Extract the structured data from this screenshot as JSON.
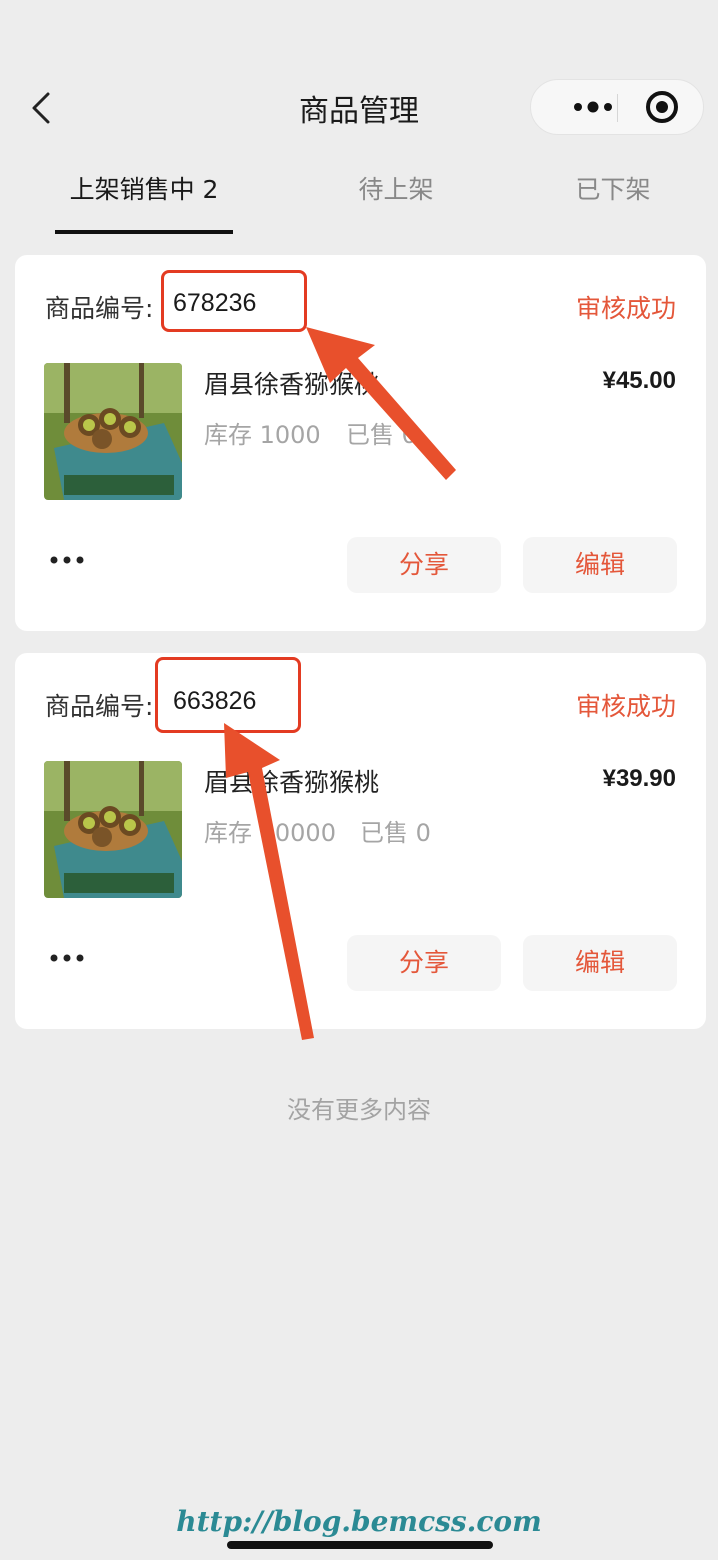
{
  "header": {
    "title": "商品管理",
    "back_icon": "chevron-left-icon",
    "more_icon": "more-dots-icon",
    "close_icon": "target-close-icon"
  },
  "tabs": [
    {
      "label": "上架销售中 2",
      "active": true
    },
    {
      "label": "待上架",
      "active": false
    },
    {
      "label": "已下架",
      "active": false
    }
  ],
  "products": [
    {
      "code_label": "商品编号:",
      "code": "678236",
      "status": "审核成功",
      "name": "眉县徐香猕猴桃",
      "price": "¥45.00",
      "stock": "库存 1000",
      "sold": "已售 0",
      "more_icon": "ellipsis-icon",
      "share_label": "分享",
      "edit_label": "编辑"
    },
    {
      "code_label": "商品编号:",
      "code": "663826",
      "status": "审核成功",
      "name": "眉县徐香猕猴桃",
      "price": "¥39.90",
      "stock": "库存 10000",
      "sold": "已售 0",
      "more_icon": "ellipsis-icon",
      "share_label": "分享",
      "edit_label": "编辑"
    }
  ],
  "footer": {
    "no_more": "没有更多内容"
  },
  "watermark": "http://blog.bemcss.com",
  "colors": {
    "accent": "#e4573a",
    "annotation": "#e33b22",
    "background": "#ededed"
  }
}
